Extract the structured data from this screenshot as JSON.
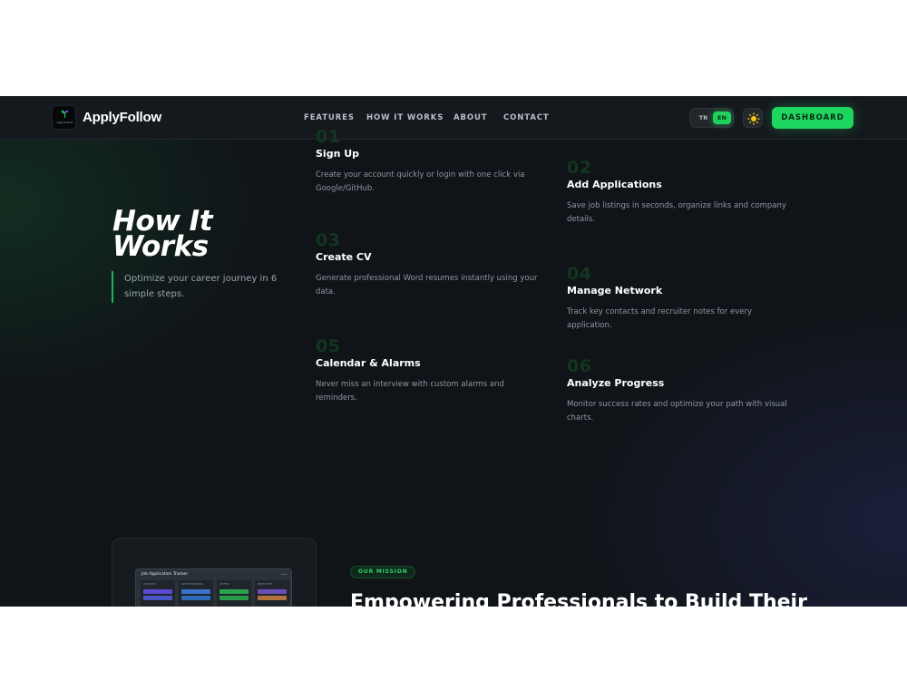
{
  "navbar": {
    "brand": "ApplyFollow",
    "logo_text": "ApplyFollow",
    "links": [
      "FEATURES",
      "HOW IT WORKS",
      "ABOUT",
      "CONTACT"
    ],
    "lang": {
      "tr": "TR",
      "en": "EN",
      "active": "EN"
    },
    "theme_icon": "sun-icon",
    "dashboard": "DASHBOARD"
  },
  "how_it_works": {
    "title_line1": "How It",
    "title_line2": "Works",
    "subtitle": "Optimize your career journey in 6 simple steps.",
    "steps": [
      {
        "num": "01",
        "title": "Sign Up",
        "desc": "Create your account quickly or login with one click via Google/GitHub."
      },
      {
        "num": "02",
        "title": "Add Applications",
        "desc": "Save job listings in seconds, organize links and company details."
      },
      {
        "num": "03",
        "title": "Create CV",
        "desc": "Generate professional Word resumes instantly using your data."
      },
      {
        "num": "04",
        "title": "Manage Network",
        "desc": "Track key contacts and recruiter notes for every application."
      },
      {
        "num": "05",
        "title": "Calendar & Alarms",
        "desc": "Never miss an interview with custom alarms and reminders."
      },
      {
        "num": "06",
        "title": "Analyze Progress",
        "desc": "Monitor success rates and optimize your path with visual charts."
      }
    ]
  },
  "mission": {
    "badge": "OUR MISSION",
    "heading": "Empowering Professionals to Build Their",
    "mock": {
      "title": "Job Application Tracker",
      "columns": [
        "APPLIED",
        "INTERVIEWING",
        "OFFER",
        "REJECTED"
      ]
    }
  },
  "colors": {
    "accent": "#1ed65f",
    "background": "#101418",
    "navbar": "#16191d"
  }
}
